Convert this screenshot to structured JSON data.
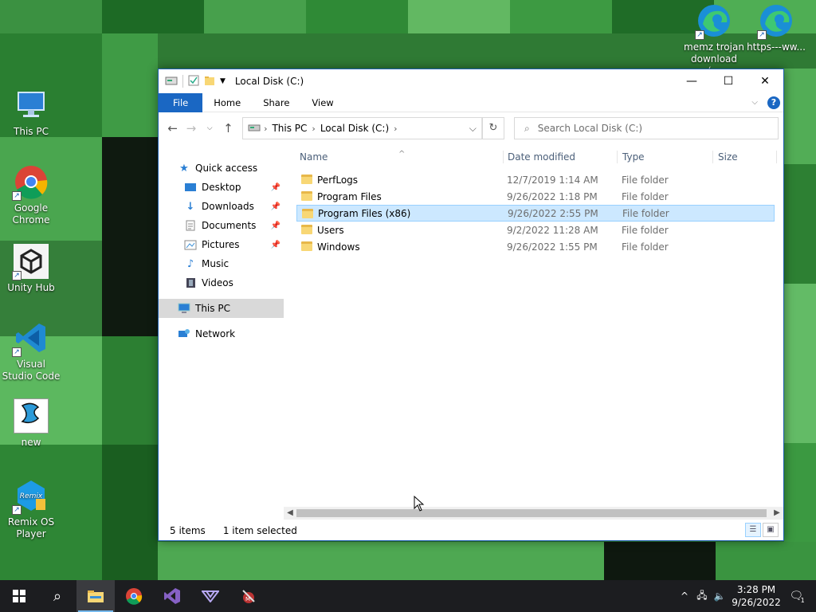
{
  "desktop": {
    "icons_left": [
      {
        "label": "This PC"
      },
      {
        "label": "Google Chrome"
      },
      {
        "label": "Unity Hub"
      },
      {
        "label": "Visual Studio Code"
      },
      {
        "label": "new"
      },
      {
        "label": "Remix OS Player"
      }
    ],
    "icons_top_right": [
      {
        "label": "memz trojan download (..."
      },
      {
        "label": "https---ww..."
      }
    ]
  },
  "window": {
    "title": "Local Disk (C:)",
    "controls": {
      "minimize": "—",
      "maximize": "☐",
      "close": "✕"
    },
    "ribbon_tabs": [
      "File",
      "Home",
      "Share",
      "View"
    ],
    "help": "?",
    "address": {
      "crumbs": [
        "This PC",
        "Local Disk (C:)"
      ]
    },
    "search_placeholder": "Search Local Disk (C:)",
    "nav_pane": {
      "quick_access": "Quick access",
      "items": [
        "Desktop",
        "Downloads",
        "Documents",
        "Pictures",
        "Music",
        "Videos"
      ],
      "this_pc": "This PC",
      "network": "Network"
    },
    "columns": {
      "name": "Name",
      "date": "Date modified",
      "type": "Type",
      "size": "Size"
    },
    "files": [
      {
        "name": "PerfLogs",
        "date": "12/7/2019 1:14 AM",
        "type": "File folder",
        "selected": false
      },
      {
        "name": "Program Files",
        "date": "9/26/2022 1:18 PM",
        "type": "File folder",
        "selected": false
      },
      {
        "name": "Program Files (x86)",
        "date": "9/26/2022 2:55 PM",
        "type": "File folder",
        "selected": true
      },
      {
        "name": "Users",
        "date": "9/2/2022 11:28 AM",
        "type": "File folder",
        "selected": false
      },
      {
        "name": "Windows",
        "date": "9/26/2022 1:55 PM",
        "type": "File folder",
        "selected": false
      }
    ],
    "status": {
      "count": "5 items",
      "selection": "1 item selected"
    }
  },
  "taskbar": {
    "clock_time": "3:28 PM",
    "clock_date": "9/26/2022",
    "notification_count": "1"
  },
  "colors": {
    "accent": "#1a67c3",
    "selection": "#cce8ff",
    "taskbar": "#1c1d20"
  }
}
